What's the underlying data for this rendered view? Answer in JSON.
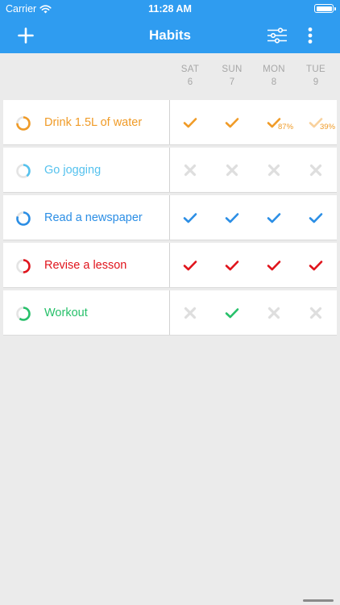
{
  "status_bar": {
    "carrier": "Carrier",
    "time": "11:28 AM"
  },
  "nav": {
    "title": "Habits",
    "left_icon": "plus-icon",
    "right_icons": [
      "sliders-icon",
      "more-vertical-icon"
    ]
  },
  "days": [
    {
      "label": "SAT",
      "num": "6"
    },
    {
      "label": "SUN",
      "num": "7"
    },
    {
      "label": "MON",
      "num": "8"
    },
    {
      "label": "TUE",
      "num": "9"
    }
  ],
  "habits": [
    {
      "name": "Drink 1.5L of water",
      "color": "#f09b27",
      "progress": 0.75,
      "cells": [
        {
          "state": "check",
          "pct": ""
        },
        {
          "state": "check",
          "pct": ""
        },
        {
          "state": "check",
          "pct": "87%"
        },
        {
          "state": "partial",
          "pct": "39%"
        }
      ]
    },
    {
      "name": "Go jogging",
      "color": "#55c2ee",
      "progress": 0.4,
      "cells": [
        {
          "state": "cross",
          "pct": ""
        },
        {
          "state": "cross",
          "pct": ""
        },
        {
          "state": "cross",
          "pct": ""
        },
        {
          "state": "cross",
          "pct": ""
        }
      ]
    },
    {
      "name": "Read a newspaper",
      "color": "#2b8ee5",
      "progress": 0.8,
      "cells": [
        {
          "state": "check",
          "pct": ""
        },
        {
          "state": "check",
          "pct": ""
        },
        {
          "state": "check",
          "pct": ""
        },
        {
          "state": "check",
          "pct": ""
        }
      ]
    },
    {
      "name": "Revise a lesson",
      "color": "#e0141c",
      "progress": 0.5,
      "cells": [
        {
          "state": "check",
          "pct": ""
        },
        {
          "state": "check",
          "pct": ""
        },
        {
          "state": "check",
          "pct": ""
        },
        {
          "state": "check",
          "pct": ""
        }
      ]
    },
    {
      "name": "Workout",
      "color": "#27c06a",
      "progress": 0.6,
      "cells": [
        {
          "state": "cross",
          "pct": ""
        },
        {
          "state": "check",
          "pct": ""
        },
        {
          "state": "cross",
          "pct": ""
        },
        {
          "state": "cross",
          "pct": ""
        }
      ]
    }
  ],
  "colors": {
    "bar": "#2f9cf0",
    "background": "#ebebeb",
    "cross": "#dedede"
  }
}
